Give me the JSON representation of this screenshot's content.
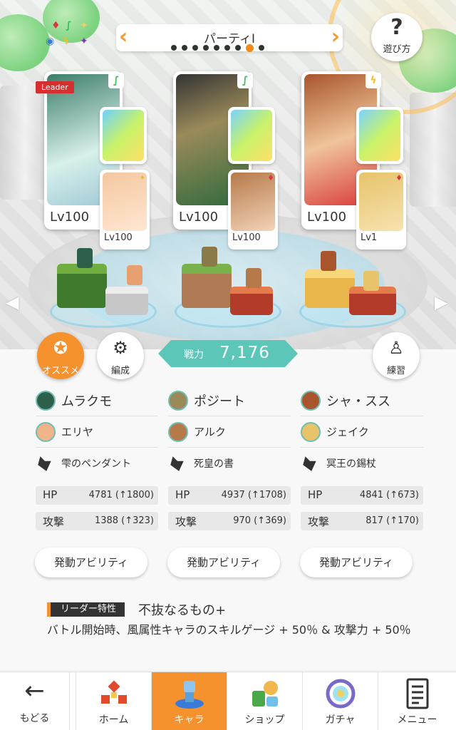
{
  "header": {
    "party_title": "パーティI",
    "prev_icon": "chevron-left-icon",
    "next_icon": "chevron-right-icon",
    "page_count": 9,
    "active_page": 8,
    "help_mark": "?",
    "help_label": "遊び方"
  },
  "party": [
    {
      "level": "Lv100",
      "leader_label": "Leader",
      "attribute": "wind",
      "attribute_color": "#3bbf5a",
      "equip_icon": "perfume-bottle-icon",
      "sub_level": "Lv100",
      "sub_attribute": "light"
    },
    {
      "level": "Lv100",
      "leader_label": "",
      "attribute": "wind",
      "attribute_color": "#3bbf5a",
      "equip_icon": "book-icon",
      "sub_level": "Lv100",
      "sub_attribute": "fire"
    },
    {
      "level": "Lv100",
      "leader_label": "",
      "attribute": "thunder",
      "attribute_color": "#f0c020",
      "equip_icon": "axe-icon",
      "sub_level": "Lv1",
      "sub_attribute": "fire"
    }
  ],
  "actions": {
    "recommend_label": "オススメ",
    "formation_label": "編成",
    "practice_label": "練習"
  },
  "power": {
    "label": "戦力",
    "value": "7,176"
  },
  "columns": [
    {
      "leader_name": "ムラクモ",
      "sub_name": "エリヤ",
      "equip_name": "雫のペンダント",
      "hp_label": "HP",
      "hp_value": "4781 (↑1800)",
      "atk_label": "攻撃",
      "atk_value": "1388 (↑323)",
      "ability_label": "発動アビリティ"
    },
    {
      "leader_name": "ポジート",
      "sub_name": "アルク",
      "equip_name": "死皇の書",
      "hp_label": "HP",
      "hp_value": "4937 (↑1708)",
      "atk_label": "攻撃",
      "atk_value": "970 (↑369)",
      "ability_label": "発動アビリティ"
    },
    {
      "leader_name": "シャ・スス",
      "sub_name": "ジェイク",
      "equip_name": "冥王の錫杖",
      "hp_label": "HP",
      "hp_value": "4841 (↑673)",
      "atk_label": "攻撃",
      "atk_value": "817 (↑170)",
      "ability_label": "発動アビリティ"
    }
  ],
  "leader_skill": {
    "tag": "リーダー特性",
    "name": "不抜なるもの+",
    "description": "バトル開始時、風属性キャラのスキルゲージ + 50％ & 攻撃力 + 50％"
  },
  "nav": {
    "back_label": "もどる",
    "items": [
      {
        "label": "ホーム",
        "icon": "home-icon"
      },
      {
        "label": "キャラ",
        "icon": "character-icon",
        "active": true
      },
      {
        "label": "ショップ",
        "icon": "shop-icon"
      },
      {
        "label": "ガチャ",
        "icon": "gacha-icon"
      },
      {
        "label": "メニュー",
        "icon": "menu-icon"
      }
    ]
  },
  "colors": {
    "accent": "#f5922e",
    "power": "#5cc6b9"
  }
}
